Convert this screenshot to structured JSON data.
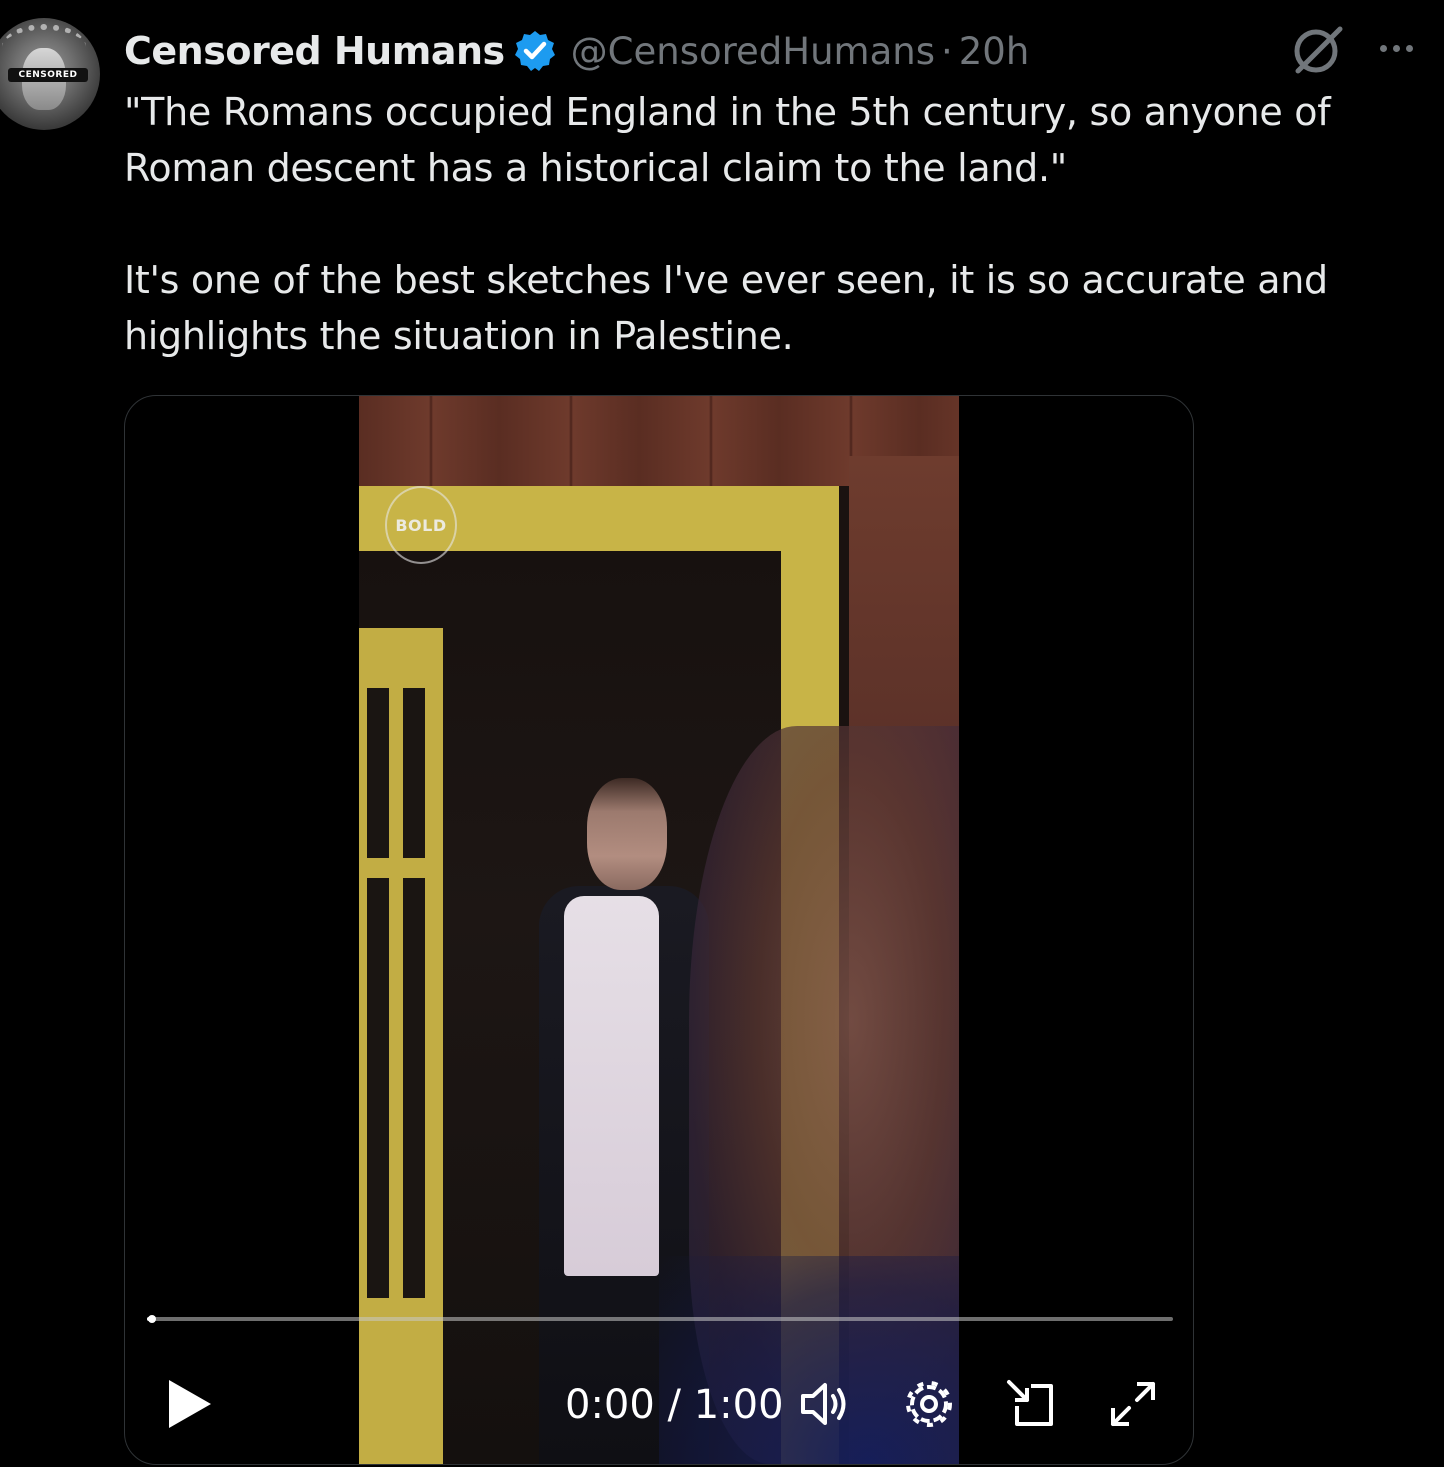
{
  "author": {
    "display_name": "Censored Humans",
    "handle": "@CensoredHumans",
    "separator": "·",
    "time": "20h",
    "avatar_badge": "CENSORED",
    "verified_color": "#1d9bf0"
  },
  "tweet": {
    "paragraphs": [
      "\"The Romans occupied England in the 5th century, so anyone of Roman descent has a historical claim to the land.\"",
      "It's one of the best sketches I've ever seen, it is so accurate and highlights the situation in Palestine."
    ]
  },
  "video": {
    "watermark": "BOLD",
    "current_time": "0:00",
    "duration": "1:00",
    "time_label": "0:00 / 1:00",
    "progress_fraction": 0.005
  },
  "icons": {
    "grok": "grok-icon",
    "more": "more-icon",
    "verified": "verified-badge-icon",
    "play": "play-icon",
    "volume": "volume-icon",
    "settings": "gear-icon",
    "pip": "picture-in-picture-icon",
    "fullscreen": "fullscreen-icon"
  },
  "colors": {
    "background": "#000000",
    "text_primary": "#e7e9ea",
    "text_secondary": "#71767b",
    "border": "#2f3336"
  }
}
